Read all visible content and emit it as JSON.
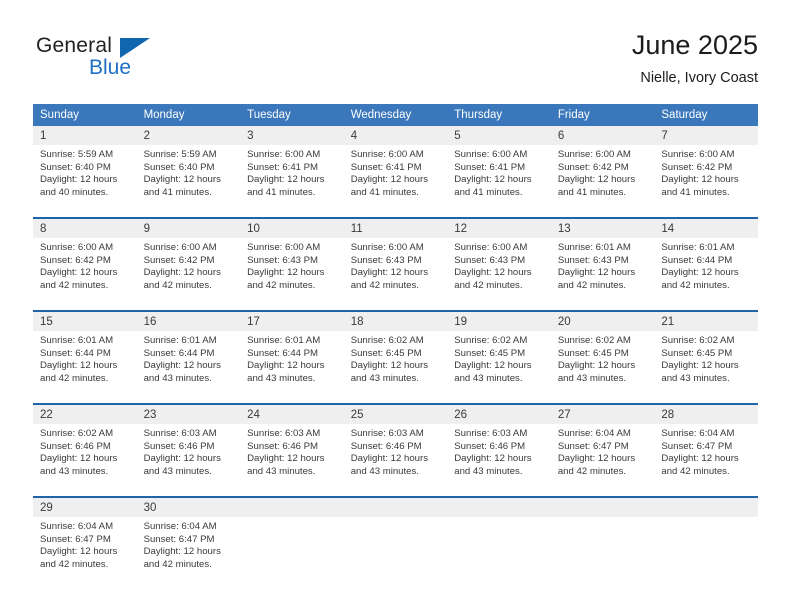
{
  "brand": {
    "name_part1": "General",
    "name_part2": "Blue",
    "triangle_color": "#1166b0",
    "blue_color": "#1f6fc4"
  },
  "header": {
    "title": "June 2025",
    "subtitle": "Nielle, Ivory Coast"
  },
  "theme": {
    "header_bg": "#3a77bb",
    "header_text": "#ffffff",
    "daynum_bg": "#efefef",
    "separator": "#1f63a8",
    "body_text": "#3a3a3a"
  },
  "calendar": {
    "weekday_headers": [
      "Sunday",
      "Monday",
      "Tuesday",
      "Wednesday",
      "Thursday",
      "Friday",
      "Saturday"
    ],
    "weeks": [
      [
        {
          "day": "1",
          "sunrise": "Sunrise: 5:59 AM",
          "sunset": "Sunset: 6:40 PM",
          "daylight_line1": "Daylight: 12 hours",
          "daylight_line2": "and 40 minutes."
        },
        {
          "day": "2",
          "sunrise": "Sunrise: 5:59 AM",
          "sunset": "Sunset: 6:40 PM",
          "daylight_line1": "Daylight: 12 hours",
          "daylight_line2": "and 41 minutes."
        },
        {
          "day": "3",
          "sunrise": "Sunrise: 6:00 AM",
          "sunset": "Sunset: 6:41 PM",
          "daylight_line1": "Daylight: 12 hours",
          "daylight_line2": "and 41 minutes."
        },
        {
          "day": "4",
          "sunrise": "Sunrise: 6:00 AM",
          "sunset": "Sunset: 6:41 PM",
          "daylight_line1": "Daylight: 12 hours",
          "daylight_line2": "and 41 minutes."
        },
        {
          "day": "5",
          "sunrise": "Sunrise: 6:00 AM",
          "sunset": "Sunset: 6:41 PM",
          "daylight_line1": "Daylight: 12 hours",
          "daylight_line2": "and 41 minutes."
        },
        {
          "day": "6",
          "sunrise": "Sunrise: 6:00 AM",
          "sunset": "Sunset: 6:42 PM",
          "daylight_line1": "Daylight: 12 hours",
          "daylight_line2": "and 41 minutes."
        },
        {
          "day": "7",
          "sunrise": "Sunrise: 6:00 AM",
          "sunset": "Sunset: 6:42 PM",
          "daylight_line1": "Daylight: 12 hours",
          "daylight_line2": "and 41 minutes."
        }
      ],
      [
        {
          "day": "8",
          "sunrise": "Sunrise: 6:00 AM",
          "sunset": "Sunset: 6:42 PM",
          "daylight_line1": "Daylight: 12 hours",
          "daylight_line2": "and 42 minutes."
        },
        {
          "day": "9",
          "sunrise": "Sunrise: 6:00 AM",
          "sunset": "Sunset: 6:42 PM",
          "daylight_line1": "Daylight: 12 hours",
          "daylight_line2": "and 42 minutes."
        },
        {
          "day": "10",
          "sunrise": "Sunrise: 6:00 AM",
          "sunset": "Sunset: 6:43 PM",
          "daylight_line1": "Daylight: 12 hours",
          "daylight_line2": "and 42 minutes."
        },
        {
          "day": "11",
          "sunrise": "Sunrise: 6:00 AM",
          "sunset": "Sunset: 6:43 PM",
          "daylight_line1": "Daylight: 12 hours",
          "daylight_line2": "and 42 minutes."
        },
        {
          "day": "12",
          "sunrise": "Sunrise: 6:00 AM",
          "sunset": "Sunset: 6:43 PM",
          "daylight_line1": "Daylight: 12 hours",
          "daylight_line2": "and 42 minutes."
        },
        {
          "day": "13",
          "sunrise": "Sunrise: 6:01 AM",
          "sunset": "Sunset: 6:43 PM",
          "daylight_line1": "Daylight: 12 hours",
          "daylight_line2": "and 42 minutes."
        },
        {
          "day": "14",
          "sunrise": "Sunrise: 6:01 AM",
          "sunset": "Sunset: 6:44 PM",
          "daylight_line1": "Daylight: 12 hours",
          "daylight_line2": "and 42 minutes."
        }
      ],
      [
        {
          "day": "15",
          "sunrise": "Sunrise: 6:01 AM",
          "sunset": "Sunset: 6:44 PM",
          "daylight_line1": "Daylight: 12 hours",
          "daylight_line2": "and 42 minutes."
        },
        {
          "day": "16",
          "sunrise": "Sunrise: 6:01 AM",
          "sunset": "Sunset: 6:44 PM",
          "daylight_line1": "Daylight: 12 hours",
          "daylight_line2": "and 43 minutes."
        },
        {
          "day": "17",
          "sunrise": "Sunrise: 6:01 AM",
          "sunset": "Sunset: 6:44 PM",
          "daylight_line1": "Daylight: 12 hours",
          "daylight_line2": "and 43 minutes."
        },
        {
          "day": "18",
          "sunrise": "Sunrise: 6:02 AM",
          "sunset": "Sunset: 6:45 PM",
          "daylight_line1": "Daylight: 12 hours",
          "daylight_line2": "and 43 minutes."
        },
        {
          "day": "19",
          "sunrise": "Sunrise: 6:02 AM",
          "sunset": "Sunset: 6:45 PM",
          "daylight_line1": "Daylight: 12 hours",
          "daylight_line2": "and 43 minutes."
        },
        {
          "day": "20",
          "sunrise": "Sunrise: 6:02 AM",
          "sunset": "Sunset: 6:45 PM",
          "daylight_line1": "Daylight: 12 hours",
          "daylight_line2": "and 43 minutes."
        },
        {
          "day": "21",
          "sunrise": "Sunrise: 6:02 AM",
          "sunset": "Sunset: 6:45 PM",
          "daylight_line1": "Daylight: 12 hours",
          "daylight_line2": "and 43 minutes."
        }
      ],
      [
        {
          "day": "22",
          "sunrise": "Sunrise: 6:02 AM",
          "sunset": "Sunset: 6:46 PM",
          "daylight_line1": "Daylight: 12 hours",
          "daylight_line2": "and 43 minutes."
        },
        {
          "day": "23",
          "sunrise": "Sunrise: 6:03 AM",
          "sunset": "Sunset: 6:46 PM",
          "daylight_line1": "Daylight: 12 hours",
          "daylight_line2": "and 43 minutes."
        },
        {
          "day": "24",
          "sunrise": "Sunrise: 6:03 AM",
          "sunset": "Sunset: 6:46 PM",
          "daylight_line1": "Daylight: 12 hours",
          "daylight_line2": "and 43 minutes."
        },
        {
          "day": "25",
          "sunrise": "Sunrise: 6:03 AM",
          "sunset": "Sunset: 6:46 PM",
          "daylight_line1": "Daylight: 12 hours",
          "daylight_line2": "and 43 minutes."
        },
        {
          "day": "26",
          "sunrise": "Sunrise: 6:03 AM",
          "sunset": "Sunset: 6:46 PM",
          "daylight_line1": "Daylight: 12 hours",
          "daylight_line2": "and 43 minutes."
        },
        {
          "day": "27",
          "sunrise": "Sunrise: 6:04 AM",
          "sunset": "Sunset: 6:47 PM",
          "daylight_line1": "Daylight: 12 hours",
          "daylight_line2": "and 42 minutes."
        },
        {
          "day": "28",
          "sunrise": "Sunrise: 6:04 AM",
          "sunset": "Sunset: 6:47 PM",
          "daylight_line1": "Daylight: 12 hours",
          "daylight_line2": "and 42 minutes."
        }
      ],
      [
        {
          "day": "29",
          "sunrise": "Sunrise: 6:04 AM",
          "sunset": "Sunset: 6:47 PM",
          "daylight_line1": "Daylight: 12 hours",
          "daylight_line2": "and 42 minutes."
        },
        {
          "day": "30",
          "sunrise": "Sunrise: 6:04 AM",
          "sunset": "Sunset: 6:47 PM",
          "daylight_line1": "Daylight: 12 hours",
          "daylight_line2": "and 42 minutes."
        },
        {
          "day": "",
          "sunrise": "",
          "sunset": "",
          "daylight_line1": "",
          "daylight_line2": ""
        },
        {
          "day": "",
          "sunrise": "",
          "sunset": "",
          "daylight_line1": "",
          "daylight_line2": ""
        },
        {
          "day": "",
          "sunrise": "",
          "sunset": "",
          "daylight_line1": "",
          "daylight_line2": ""
        },
        {
          "day": "",
          "sunrise": "",
          "sunset": "",
          "daylight_line1": "",
          "daylight_line2": ""
        },
        {
          "day": "",
          "sunrise": "",
          "sunset": "",
          "daylight_line1": "",
          "daylight_line2": ""
        }
      ]
    ]
  }
}
